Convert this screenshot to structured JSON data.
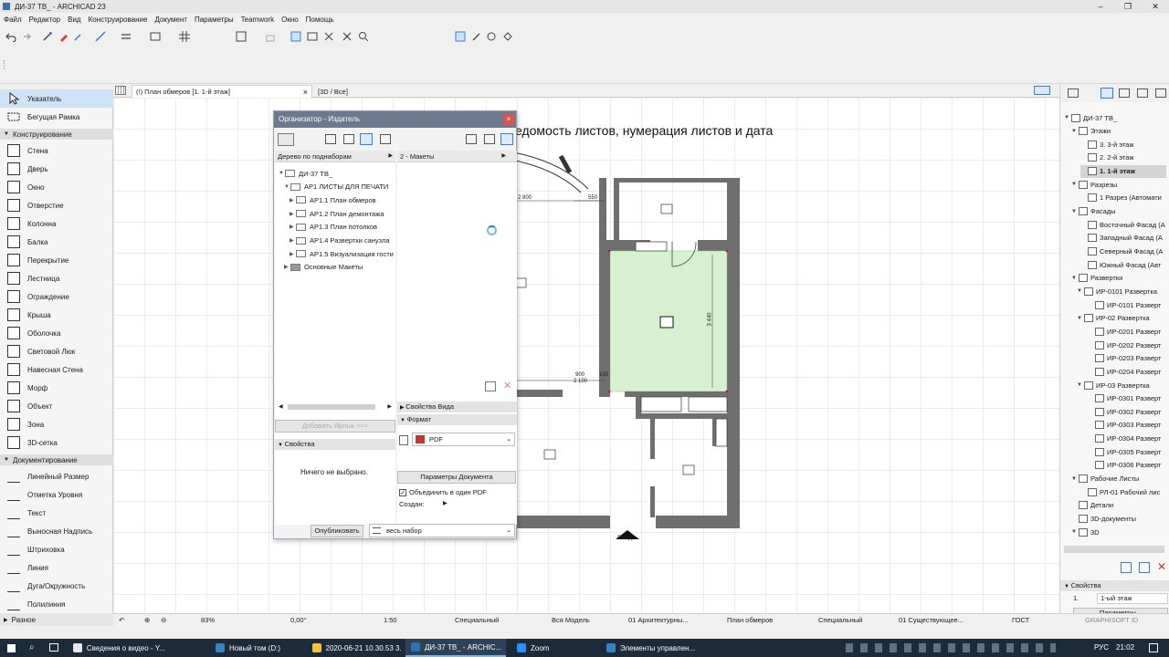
{
  "window": {
    "title": "ДИ-37 ТВ_ - ARCHICAD 23"
  },
  "menu": [
    "Файл",
    "Редактор",
    "Вид",
    "Конструирование",
    "Документ",
    "Параметры",
    "Teamwork",
    "Окно",
    "Помощь"
  ],
  "tabs": [
    {
      "label": "(!) План обмеров [1. 1-й этаж]",
      "close": "×"
    },
    {
      "label": "[3D / Все]"
    }
  ],
  "toolbox": {
    "pointer": "Указатель",
    "marquee": "Бегущая Рамка",
    "group_design": "Конструирование",
    "design_tools": [
      "Стена",
      "Дверь",
      "Окно",
      "Отверстие",
      "Колонна",
      "Балка",
      "Перекрытие",
      "Лестница",
      "Ограждение",
      "Крыша",
      "Оболочка",
      "Световой Люк",
      "Навесная Стена",
      "Морф",
      "Объект",
      "Зона",
      "3D-сетка"
    ],
    "group_doc": "Документирование",
    "doc_tools": [
      "Линейный Размер",
      "Отметка Уровня",
      "Текст",
      "Выносная Надпись",
      "Штриховка",
      "Линия",
      "Дуга/Окружность",
      "Полилиния"
    ],
    "group_misc": "Разное"
  },
  "canvas": {
    "heading": "едомость листов, нумерация листов и дата",
    "dims": {
      "d1": "2 800",
      "d2": "550",
      "d3": "3 440",
      "d4": "900",
      "d5": "2 100",
      "d6": "100"
    },
    "entrance": "ВХОД"
  },
  "dialog": {
    "title": "Организатор - Издатель",
    "left_header": "Дерево по поднаборам",
    "right_header": "2 - Макеты",
    "tree": {
      "root": "ДИ-37 ТВ_",
      "set": "АР1 ЛИСТЫ ДЛЯ ПЕЧАТИ",
      "items": [
        "АР1.1 План обмеров",
        "АР1.2 План демонтажа",
        "АР1.3 План потолков",
        "АР1.4 Развертки санузла",
        "АР1.5 Визуализация гости"
      ],
      "other": "Основные Макеты"
    },
    "add_shortcut": "Добавить Ярлык >>>",
    "properties_section": "Свойства",
    "nothing_selected": "Ничего не выбрано.",
    "view_props": "Свойства Вида",
    "format_section": "Формат",
    "format_value": "PDF",
    "doc_params": "Параметры Документа",
    "merge_pdf": "Объединить в один PDF",
    "create_label": "Создан:",
    "publish": "Опубликовать",
    "scope": "весь набор"
  },
  "navigator": {
    "root": "ДИ-37 ТВ_",
    "stories_label": "Этажи",
    "stories": [
      "3. 3-й этаж",
      "2. 2-й этаж",
      "1. 1-й этаж"
    ],
    "sections_label": "Разрезы",
    "sections": [
      "1 Разрез (Автомати"
    ],
    "facades_label": "Фасады",
    "facades": [
      "Восточный Фасад (А",
      "Западный Фасад (А",
      "Северный Фасад (А",
      "Южный Фасад (Авт"
    ],
    "elev_label": "Развертки",
    "elev_groups": [
      {
        "name": "ИР-0101 Развертка",
        "items": [
          "ИР-0101 Разверт"
        ]
      },
      {
        "name": "ИР-02  Развертка",
        "items": [
          "ИР-0201 Разверт",
          "ИР-0202 Разверт",
          "ИР-0203 Разверт",
          "ИР-0204 Разверт"
        ]
      },
      {
        "name": "ИР-03  Развертка",
        "items": [
          "ИР-0301 Разверт",
          "ИР-0302 Разверт",
          "ИР-0303 Разверт",
          "ИР-0304 Разверт",
          "ИР-0305 Разверт",
          "ИР-0306 Разверт"
        ]
      }
    ],
    "worksheets_label": "Рабочие Листы",
    "worksheets": [
      "РЛ-01 Рабочий лис"
    ],
    "details": "Детали",
    "docs3d": "3D-документы",
    "label3d": "3D",
    "props_label": "Свойства",
    "props_num": "1.",
    "props_value": "1-ый этаж",
    "params_btn": "Параметры..."
  },
  "status": {
    "zoom": "83%",
    "angle": "0,00°",
    "scale": "1:50",
    "pen": "Специальный",
    "model": "Вся Модель",
    "layers": "01 Архитектурны...",
    "view": "План обмеров",
    "pen2": "Специальный",
    "renovation": "01 Существующее...",
    "standard": "ГОСТ",
    "brand": "GRAPHISOFT ID"
  },
  "taskbar": {
    "items": [
      "Сведения о видео - Y...",
      "Новый том (D:)",
      "2020-06-21 10.30.53 3...",
      "ДИ-37 ТВ_ - ARCHIC...",
      "Zoom",
      "Элементы управлен..."
    ],
    "lang": "РУС",
    "time": "21:02"
  },
  "colors": {
    "zone_fill": "#d7f0cf",
    "wall": "#6f6f6f",
    "selection": "#cfe3f7",
    "dialog_title": "#6b7a8f"
  }
}
